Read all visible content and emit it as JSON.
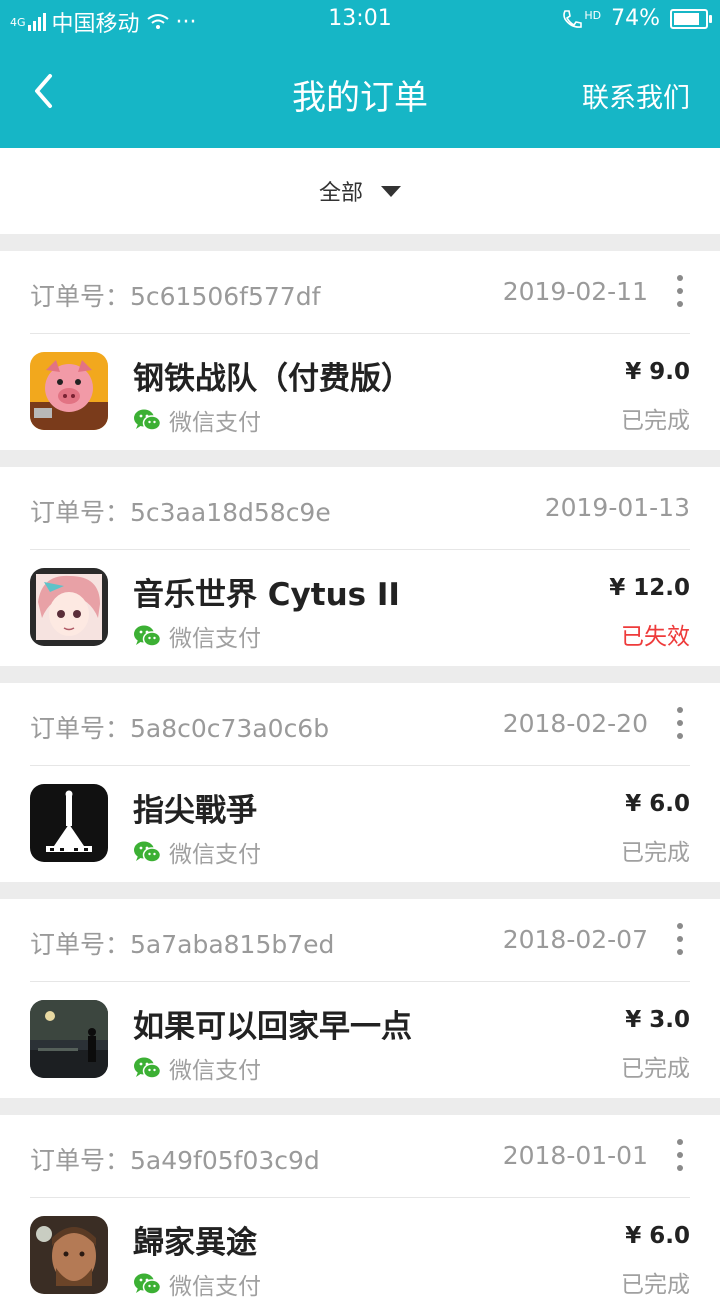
{
  "status_bar": {
    "network": "4G",
    "carrier": "中国移动",
    "more": "···",
    "time": "13:01",
    "hd": "HD",
    "battery": "74%"
  },
  "nav": {
    "title": "我的订单",
    "action": "联系我们"
  },
  "filter": {
    "selected": "全部"
  },
  "colors": {
    "accent": "#16b6c6",
    "failed": "#ee3b3b",
    "wechat": "#3cb034"
  },
  "orders": [
    {
      "order_label": "订单号：5c61506f577df",
      "date": "2019-02-11",
      "has_menu": true,
      "app_name": "钢铁战队（付费版）",
      "pay_method": "微信支付",
      "price": "¥ 9.0",
      "status": "已完成"
    },
    {
      "order_label": "订单号：5c3aa18d58c9e",
      "date": "2019-01-13",
      "has_menu": false,
      "app_name": "音乐世界 Cytus II",
      "pay_method": "微信支付",
      "price": "¥ 12.0",
      "status": "已失效"
    },
    {
      "order_label": "订单号：5a8c0c73a0c6b",
      "date": "2018-02-20",
      "has_menu": true,
      "app_name": "指尖戰爭",
      "pay_method": "微信支付",
      "price": "¥ 6.0",
      "status": "已完成"
    },
    {
      "order_label": "订单号：5a7aba815b7ed",
      "date": "2018-02-07",
      "has_menu": true,
      "app_name": "如果可以回家早一点",
      "pay_method": "微信支付",
      "price": "¥ 3.0",
      "status": "已完成"
    },
    {
      "order_label": "订单号：5a49f05f03c9d",
      "date": "2018-01-01",
      "has_menu": true,
      "app_name": "歸家異途",
      "pay_method": "微信支付",
      "price": "¥ 6.0",
      "status": "已完成"
    }
  ]
}
